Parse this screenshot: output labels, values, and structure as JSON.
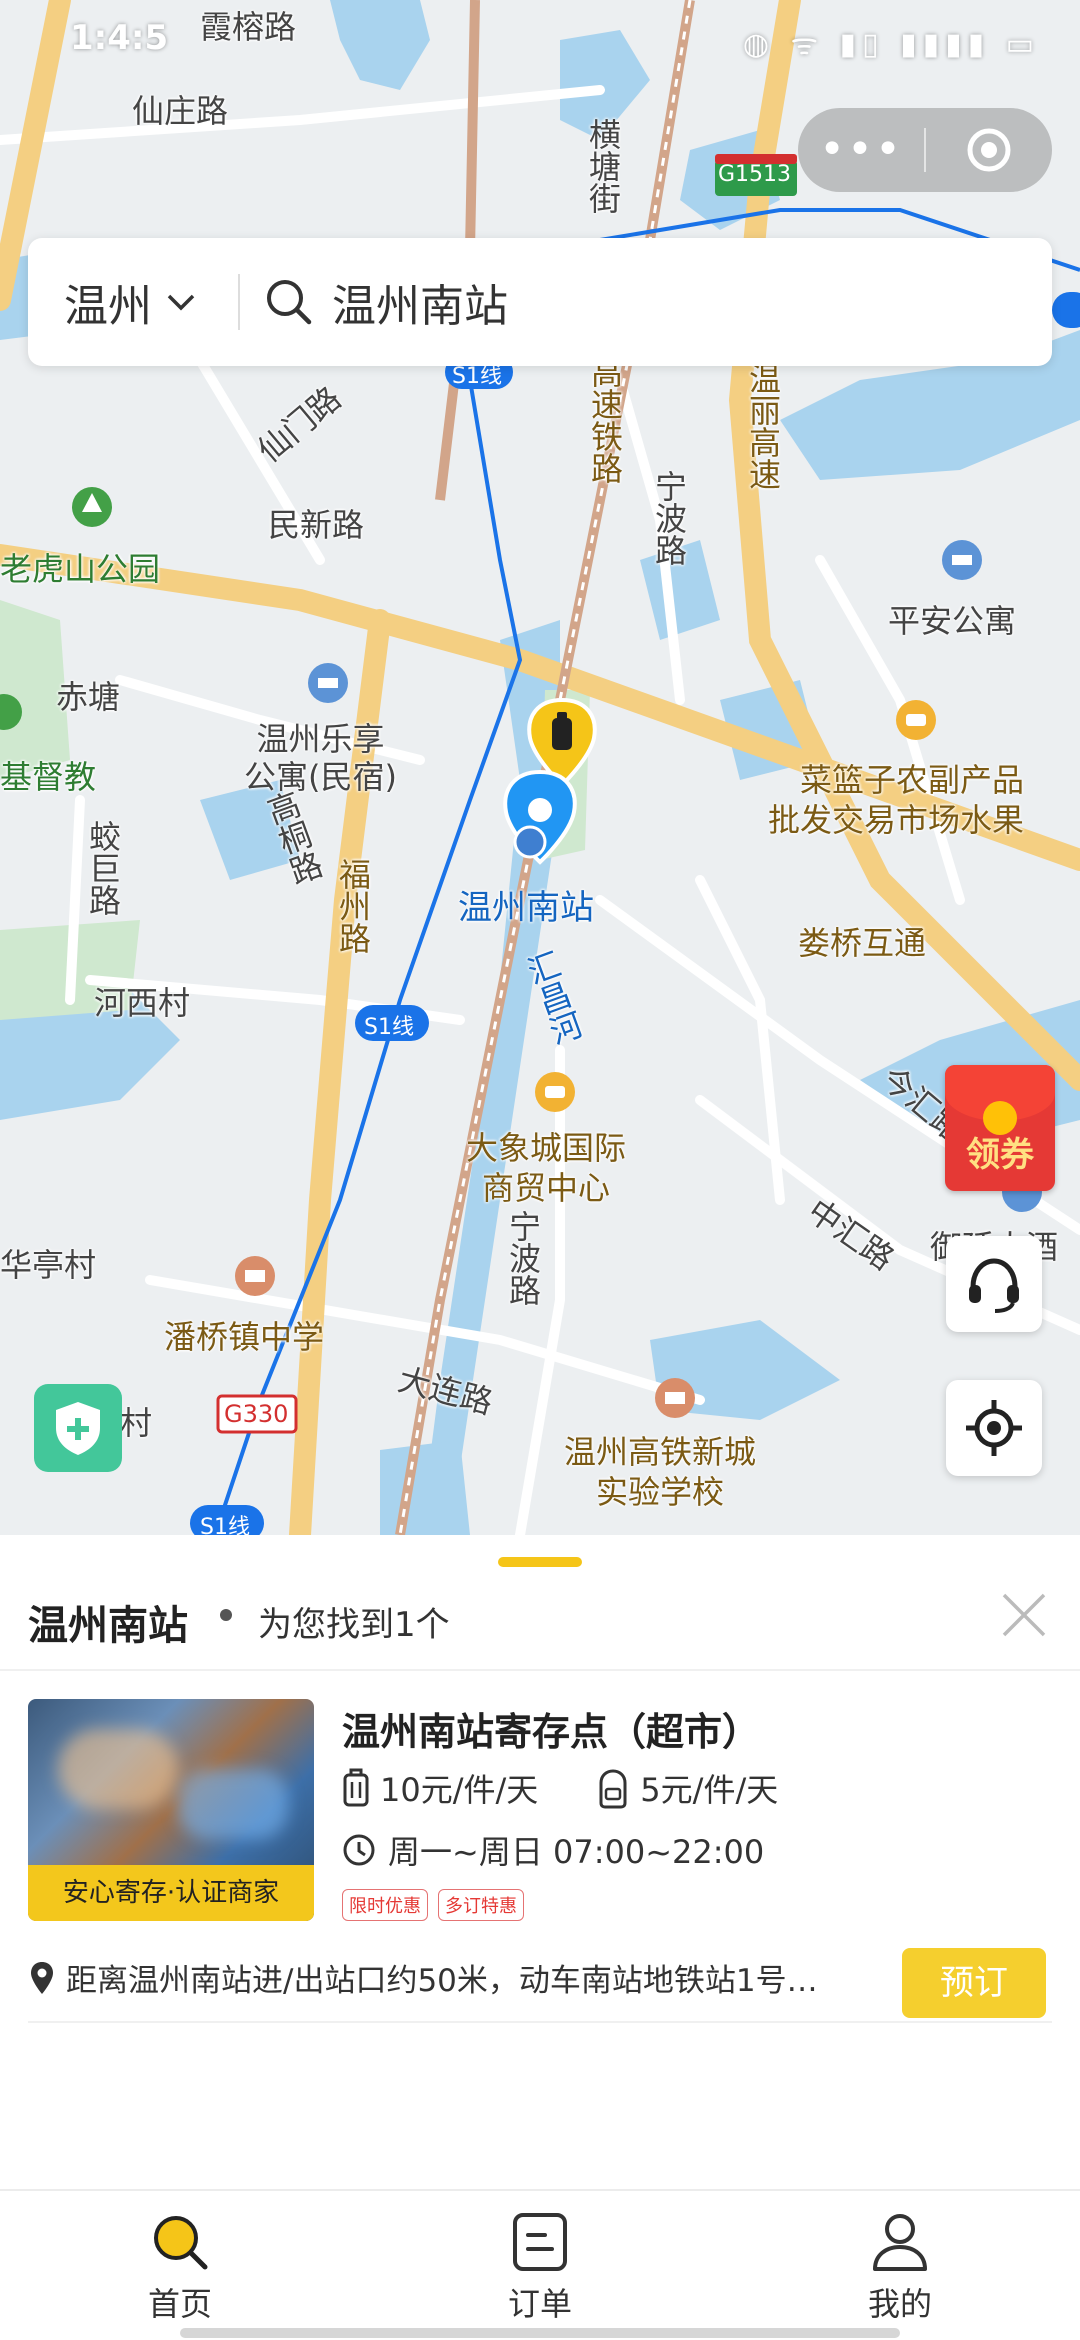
{
  "status_bar": {
    "time": "1:4:5",
    "icons": "◍ ᯤ ▮▯ ▮▮▮▮ ▭"
  },
  "capsule": {
    "more_icon": "more-icon",
    "close_icon": "target-icon"
  },
  "search": {
    "city": "温州",
    "query": "温州南站"
  },
  "map": {
    "labels": {
      "xiarong_rd": "霞榕路",
      "xianzhuang_rd": "仙庄路",
      "hengtang_st": "横塘街",
      "g1513": "G1513",
      "s1_top": "S1线",
      "xianmen_rd": "仙门路",
      "minxin_rd": "民新路",
      "gaosu_tielu": "高速铁路",
      "ningbo_rd_top": "宁波路",
      "wenli_gaosu": "温丽高速",
      "laohushan_park": "老虎山公园",
      "pingan_apt": "平安公寓",
      "chitang": "赤塘",
      "jidujiao": "基督教",
      "wenzhou_lexiang": "温州乐享\n公寓(民宿)",
      "caolanzi_market": "菜篮子农副产品\n批发交易市场水果",
      "gaotong_rd": "高桐路",
      "jiaoju_rd": "蛟巨路",
      "fuzhou_rd": "福州路",
      "wenzhou_south_station": "温州南站",
      "louqiao_interchange": "娄桥互通",
      "hexi_village": "河西村",
      "s1_mid": "S1线",
      "huichang_river": "汇昌河",
      "jinhui_rd": "今汇路",
      "daxiangcheng": "大象城国际\n商贸中心",
      "zhonghui_rd": "中汇路",
      "yujing_hotel": "御廷大酒",
      "huating_village": "华亭村",
      "ningbo_rd_bottom": "宁波路",
      "panqiao_school": "潘桥镇中学",
      "dalian_rd": "大连路",
      "g330": "G330",
      "cun": "村",
      "wenzhou_hsr_school": "温州高铁新城\n实验学校",
      "s1_bottom": "S1线"
    }
  },
  "red_packet": {
    "label": "领券"
  },
  "sheet": {
    "title": "温州南站",
    "found_text": "为您找到1个",
    "store": {
      "name": "温州南站寄存点（超市）",
      "image_badge": "安心寄存·认证商家",
      "price_large": "10元/件/天",
      "price_small": "5元/件/天",
      "hours": "周一~周日 07:00~22:00",
      "tags": [
        "限时优惠",
        "多订特惠"
      ],
      "address": "距离温州南站进/出站口约50米，动车南站地铁站1号…",
      "book_label": "预订"
    }
  },
  "tabbar": {
    "tabs": [
      {
        "label": "首页",
        "active": true
      },
      {
        "label": "订单",
        "active": false
      },
      {
        "label": "我的",
        "active": false
      }
    ]
  },
  "colors": {
    "accent": "#f5c518",
    "map_water": "#a9d3ee",
    "map_road_main": "#f7d38a",
    "map_road_rail": "#d7a88c",
    "metro_line": "#1a73e8",
    "green_area": "#c8e6c9"
  }
}
